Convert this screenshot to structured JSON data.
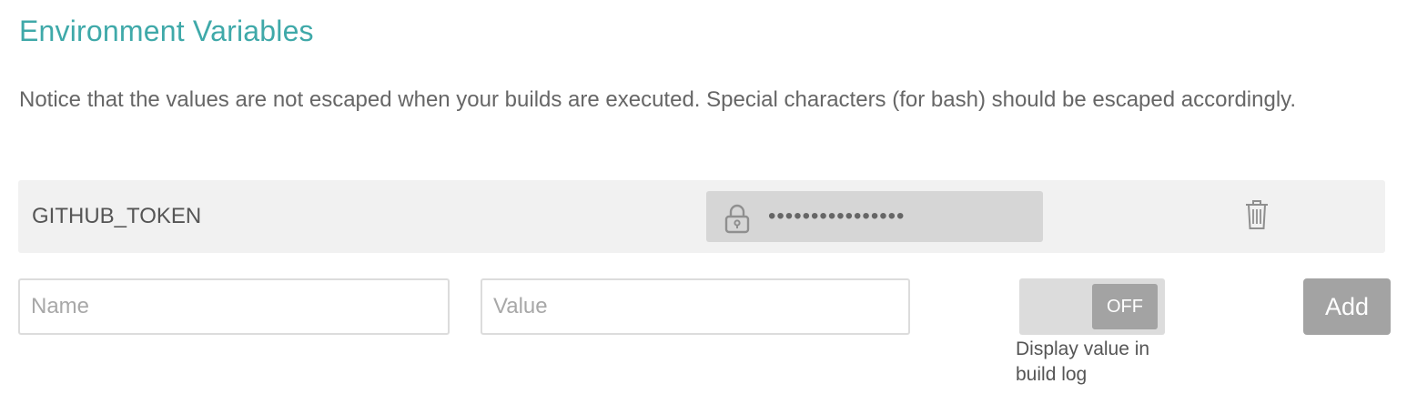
{
  "section": {
    "title": "Environment Variables",
    "notice": "Notice that the values are not escaped when your builds are executed. Special characters (for bash) should be escaped accordingly."
  },
  "variables": [
    {
      "name": "GITHUB_TOKEN",
      "masked_value": "••••••••••••••••",
      "value_icon": "lock-icon",
      "delete_icon": "trash-icon"
    }
  ],
  "new_variable": {
    "name_value": "",
    "name_placeholder": "Name",
    "value_value": "",
    "value_placeholder": "Value",
    "display_toggle": {
      "state": "OFF",
      "label": "Display value in build log"
    },
    "add_label": "Add"
  },
  "colors": {
    "title": "#3fa9a9",
    "row_background": "#f1f1f1",
    "masked_field": "#d6d6d6",
    "button": "#a3a3a3"
  }
}
